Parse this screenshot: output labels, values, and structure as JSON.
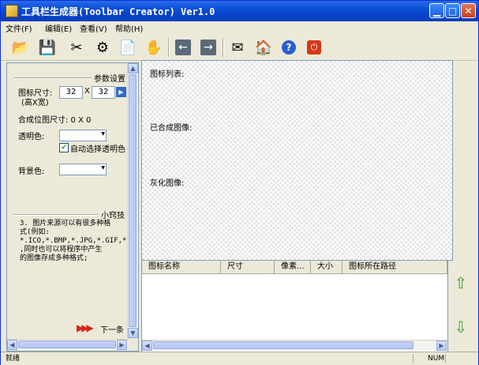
{
  "window": {
    "title": "工具栏生成器(Toolbar Creator) Ver1.0"
  },
  "menu": [
    {
      "label": "文件(F)"
    },
    {
      "label": "编辑(E)"
    },
    {
      "label": "查看(V)"
    },
    {
      "label": "帮助(H)"
    }
  ],
  "toolbar": {
    "icons": [
      "open-folder-icon",
      "save-icon",
      "cut-icon",
      "settings-gears-icon",
      "document-icon",
      "hand-tool-icon",
      "back-arrow-icon",
      "forward-arrow-icon",
      "mail-icon",
      "home-icon",
      "help-icon",
      "power-icon"
    ]
  },
  "params": {
    "section_title": "参数设置",
    "icon_size_label": "图标尺寸:",
    "icon_size_sub": "(高X宽)",
    "height_value": "32",
    "times": "X",
    "width_value": "32",
    "combined_size_label": "合成位图尺寸: 0 X 0",
    "transparent_label": "透明色:",
    "auto_transparent_label": "自动选择透明色",
    "background_label": "背景色:"
  },
  "tips": {
    "section_title": "小窍技",
    "text": "3. 图片来源可以有很多种格\n式(例如:\n*.ICO,*.BMP,*.JPG,*.GIF,*.\n,同时也可以将程序中产生\n的图像存成多种格式;",
    "next_label": "下一条"
  },
  "canvas": {
    "icon_list_label": "图标列表:",
    "combined_label": "已合成图像:",
    "gray_label": "灰化图像:"
  },
  "table": {
    "columns": [
      "图标名称",
      "尺寸",
      "像素...",
      "大小",
      "图标所在路径"
    ]
  },
  "status": {
    "left": "就绪",
    "num": "NUM"
  }
}
